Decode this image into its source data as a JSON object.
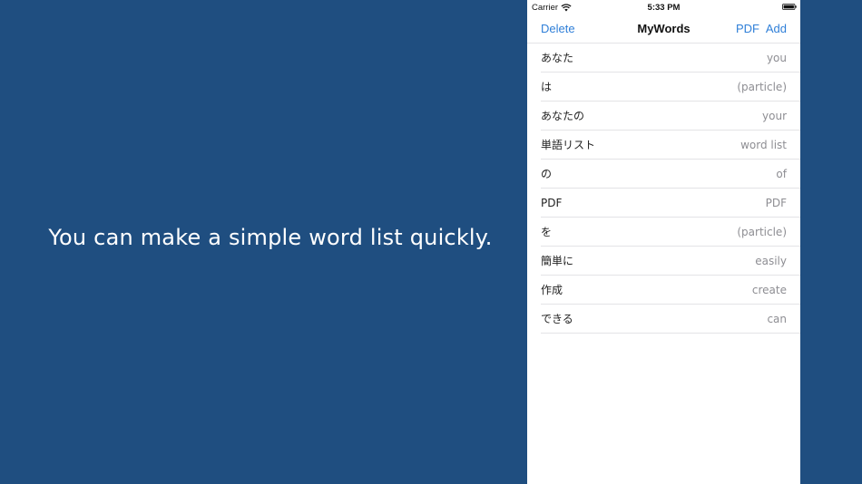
{
  "promo": {
    "caption": "You can make a simple word list quickly."
  },
  "status_bar": {
    "carrier": "Carrier",
    "time": "5:33 PM",
    "icons": [
      "wifi-icon",
      "battery-icon"
    ]
  },
  "nav": {
    "left_button": "Delete",
    "title": "MyWords",
    "pdf_button": "PDF",
    "add_button": "Add"
  },
  "colors": {
    "background": "#1f4e80",
    "accent": "#2f7fd8",
    "secondary_text": "#8e8e93"
  },
  "words": [
    {
      "term": "あなた",
      "meaning": "you"
    },
    {
      "term": "は",
      "meaning": "(particle)"
    },
    {
      "term": "あなたの",
      "meaning": "your"
    },
    {
      "term": "単語リスト",
      "meaning": "word list"
    },
    {
      "term": "の",
      "meaning": "of"
    },
    {
      "term": "PDF",
      "meaning": "PDF"
    },
    {
      "term": "を",
      "meaning": "(particle)"
    },
    {
      "term": "簡単に",
      "meaning": "easily"
    },
    {
      "term": "作成",
      "meaning": "create"
    },
    {
      "term": "できる",
      "meaning": "can"
    }
  ]
}
